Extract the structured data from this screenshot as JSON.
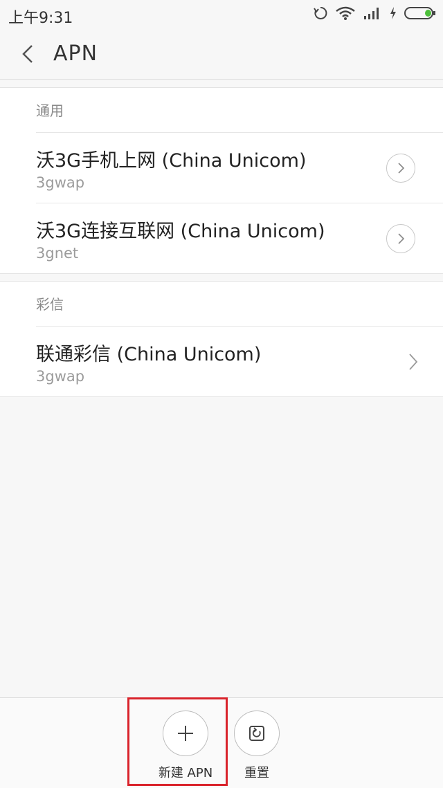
{
  "status": {
    "time": "上午9:31",
    "icons": [
      "sync-icon",
      "wifi-icon",
      "signal-icon",
      "charging-icon",
      "battery-icon"
    ]
  },
  "header": {
    "title": "APN"
  },
  "sections": [
    {
      "header": "通用",
      "items": [
        {
          "title": "沃3G手机上网 (China Unicom)",
          "subtitle": "3gwap"
        },
        {
          "title": "沃3G连接互联网 (China Unicom)",
          "subtitle": "3gnet"
        }
      ]
    },
    {
      "header": "彩信",
      "items": [
        {
          "title": "联通彩信 (China Unicom)",
          "subtitle": "3gwap"
        }
      ]
    }
  ],
  "bottom": {
    "new_apn_label": "新建 APN",
    "reset_label": "重置"
  },
  "colors": {
    "highlight": "#d9232b",
    "battery_level": "#4cbf3a"
  }
}
